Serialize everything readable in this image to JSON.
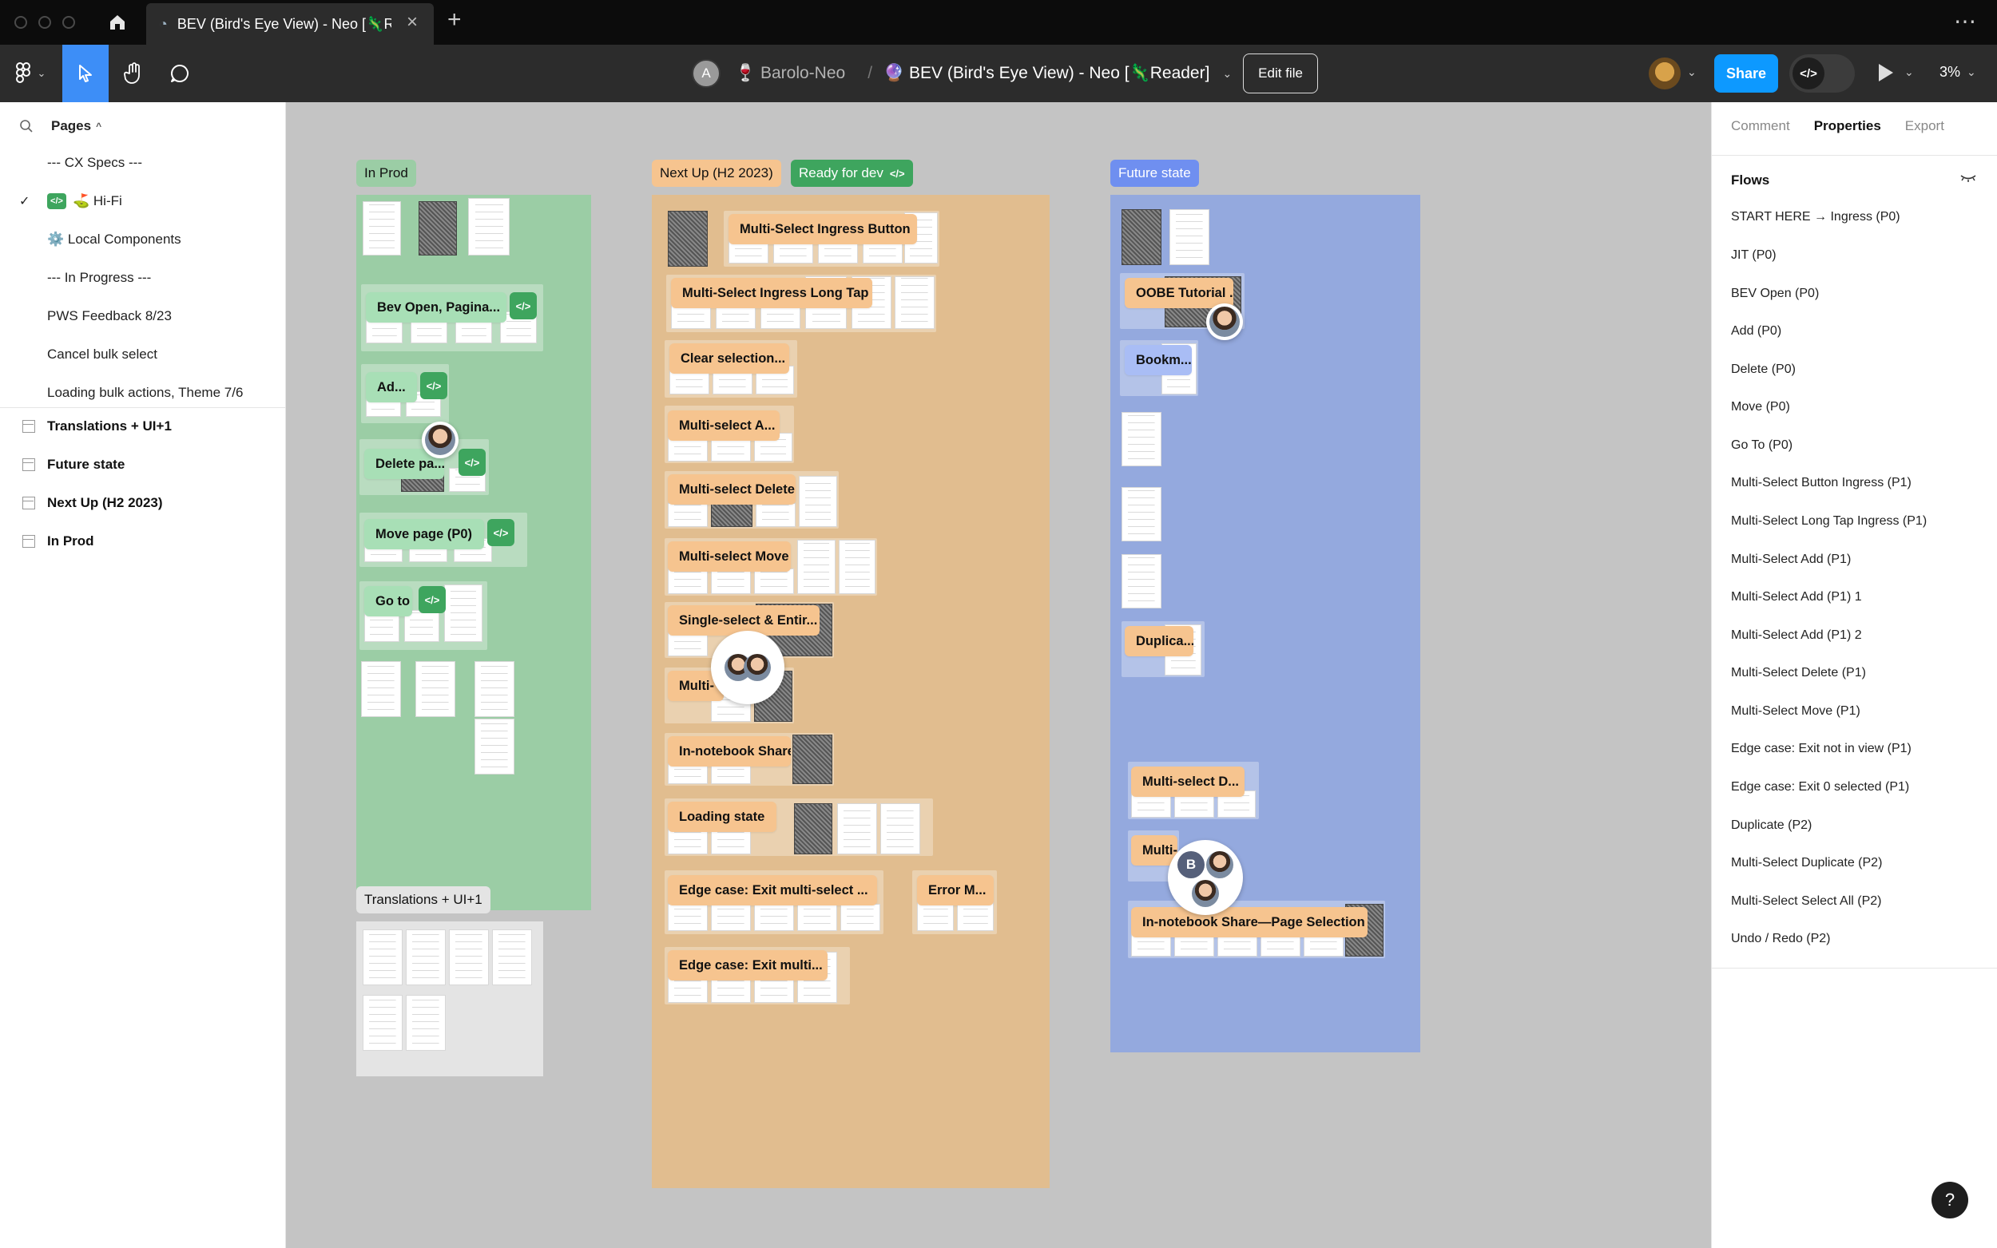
{
  "window": {
    "tab_title": "BEV (Bird's Eye View) - Neo [🦎Rea",
    "tab_globe_icon": "globe-icon"
  },
  "toolbar": {
    "avatar_initial": "A",
    "team": "🍷 Barolo-Neo",
    "separator": "/",
    "file_name": "🔮 BEV (Bird's Eye View) - Neo [🦎Reader]",
    "edit_file": "Edit file",
    "share": "Share",
    "dev_mode_glyph": "</>",
    "zoom": "3%"
  },
  "left": {
    "pages_title": "Pages",
    "pages": [
      {
        "label": "--- CX Specs ---",
        "checked": false
      },
      {
        "label": "⛳ Hi-Fi",
        "checked": true,
        "badge": "</>"
      },
      {
        "label": "⚙️ Local Components",
        "checked": false
      },
      {
        "label": "--- In Progress ---",
        "checked": false
      },
      {
        "label": "PWS Feedback 8/23",
        "checked": false
      },
      {
        "label": "Cancel bulk select",
        "checked": false
      },
      {
        "label": "Loading bulk actions, Theme 7/6",
        "checked": false
      }
    ],
    "frames": [
      "Translations + UI+1",
      "Future state",
      "Next Up (H2 2023)",
      "In Prod"
    ]
  },
  "right": {
    "tabs": [
      "Comment",
      "Properties",
      "Export"
    ],
    "active_tab": "Properties",
    "flows_title": "Flows",
    "flows": [
      "START HERE → Ingress (P0)",
      "JIT (P0)",
      "BEV Open (P0)",
      "Add (P0)",
      "Delete (P0)",
      "Move (P0)",
      "Go To (P0)",
      "Multi-Select Button Ingress (P1)",
      "Multi-Select Long Tap Ingress (P1)",
      "Multi-Select Add (P1)",
      "Multi-Select Add (P1) 1",
      "Multi-Select Add (P1) 2",
      "Multi-Select Delete (P1)",
      "Multi-Select Move (P1)",
      "Edge case: Exit not in view (P1)",
      "Edge case: Exit 0 selected (P1)",
      "Duplicate (P2)",
      "Multi-Select Duplicate (P2)",
      "Multi-Select Select All (P2)",
      "Undo / Redo (P2)"
    ],
    "help": "?"
  },
  "canvas": {
    "sections": {
      "in_prod": "In Prod",
      "next_up": "Next Up (H2 2023)",
      "ready_for_dev": "Ready for dev",
      "future_state": "Future state",
      "translations": "Translations + UI+1"
    },
    "in_prod_tags": [
      "Bev Open, Pagina...",
      "Ad...",
      "Delete pa...",
      "Move page (P0)",
      "Go to"
    ],
    "next_up_tags": [
      "Multi-Select Ingress Button",
      "Multi-Select Ingress Long Tap",
      "Clear selection...",
      "Multi-select A...",
      "Multi-select Delete",
      "Multi-select Move",
      "Single-select & Entir...",
      "Multi-",
      "In-notebook Share",
      "Loading state",
      "Edge case: Exit multi-select ...",
      "Error M...",
      "Edge case: Exit multi..."
    ],
    "future_tags": [
      "OOBE Tutorial ...",
      "Bookm...",
      "Duplica...",
      "Multi-select  D...",
      "Multi-",
      "In-notebook Share—Page Selection"
    ],
    "collaborator_initial": "B",
    "colors": {
      "in_prod": "#9bcda5",
      "next_up": "#e1bd8f",
      "future": "#94a9de",
      "translations": "#e4e4e4",
      "accent": "#0d99ff"
    }
  }
}
